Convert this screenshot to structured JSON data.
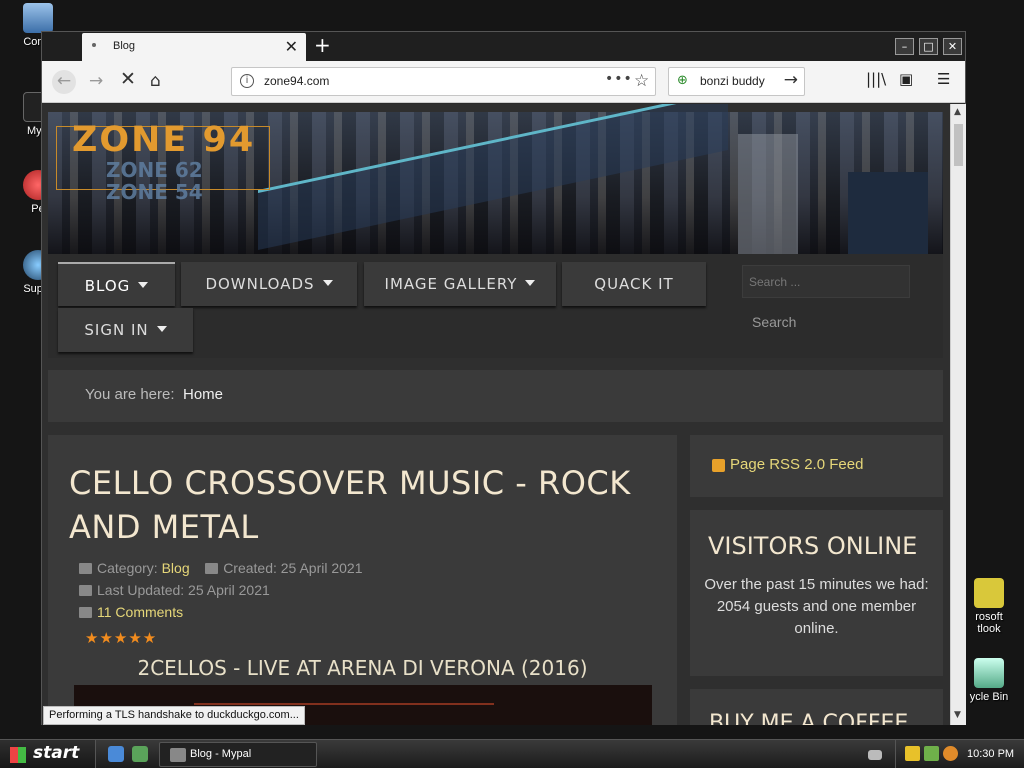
{
  "desktop": {
    "icons": [
      {
        "label": "Comp"
      },
      {
        "label": "MyP"
      },
      {
        "label": "Pe"
      },
      {
        "label": "Super"
      },
      {
        "label": "rosoft\ntlook"
      },
      {
        "label": "ycle Bin"
      }
    ]
  },
  "browser": {
    "tab_title": "Blog",
    "new_tab_symbol": "+",
    "url": "zone94.com",
    "search_text": "bonzi buddy",
    "status_text": "Performing a TLS handshake to duckduckgo.com..."
  },
  "site": {
    "logo_main": "ZONE 94",
    "logo_sub1": "ZONE 62",
    "logo_sub2": "ZONE 54",
    "menu": [
      {
        "label": "BLOG"
      },
      {
        "label": "DOWNLOADS"
      },
      {
        "label": "IMAGE GALLERY"
      },
      {
        "label": "QUACK IT"
      },
      {
        "label": "SIGN IN"
      }
    ],
    "search_placeholder": "Search ...",
    "search_button": "Search",
    "breadcrumb_label": "You are here:",
    "breadcrumb_home": "Home"
  },
  "article": {
    "title": "CELLO CROSSOVER MUSIC - ROCK AND METAL",
    "category_label": "Category:",
    "category": "Blog",
    "created": "Created: 25 April 2021",
    "updated": "Last Updated: 25 April 2021",
    "comments": "11 Comments",
    "rating": "★★★★★",
    "rating_value": 5,
    "subtitle": "2CELLOS - LIVE AT ARENA DI VERONA (2016)"
  },
  "sidebar": {
    "rss": "Page RSS 2.0 Feed",
    "visitors_title": "VISITORS ONLINE",
    "visitors_text": "Over the past 15 minutes we had:\n2054 guests and one member online.",
    "coffee_title": "BUY ME A COFFEE"
  },
  "taskbar": {
    "start_label": "start",
    "task_label": "Blog - Mypal",
    "clock": "10:30 PM"
  },
  "colors": {
    "page_bg": "#2f2f2f",
    "panel_bg": "#3a3a3a",
    "accent_link": "#e6d779",
    "heading": "#f3e7cf",
    "logo": "#e29a2f",
    "stars": "#f28c1e"
  }
}
